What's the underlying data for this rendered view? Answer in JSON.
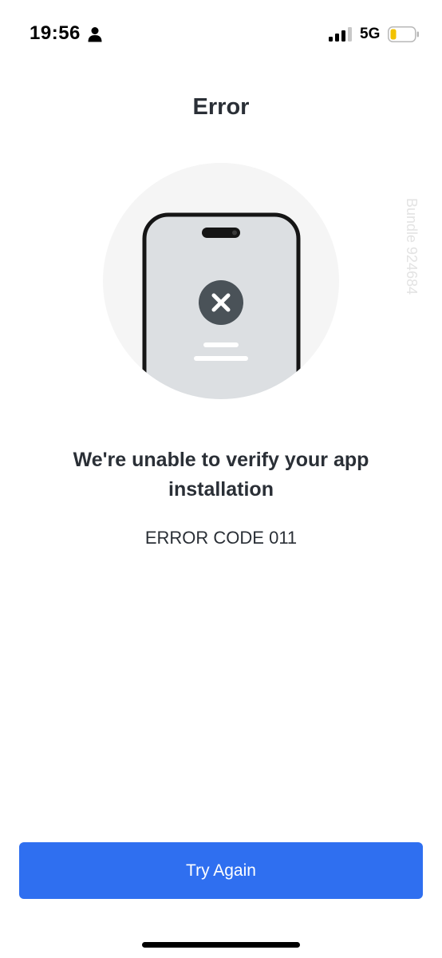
{
  "status_bar": {
    "time": "19:56",
    "network": "5G",
    "icons": [
      "person-icon",
      "cellular-signal-icon",
      "battery-low-icon"
    ],
    "battery_color": "#f2c200"
  },
  "page": {
    "title": "Error",
    "watermark": "Bundle 924684",
    "headline": "We're unable to verify your app installation",
    "error_code": "ERROR CODE 011",
    "illustration_icon": "phone-error-icon"
  },
  "actions": {
    "try_again_label": "Try Again"
  },
  "colors": {
    "accent": "#2f6ff0",
    "text": "#2a2f36",
    "error_badge": "#4a5258",
    "illustration_bg": "#f5f5f5",
    "phone_screen": "#dcdfe2"
  }
}
